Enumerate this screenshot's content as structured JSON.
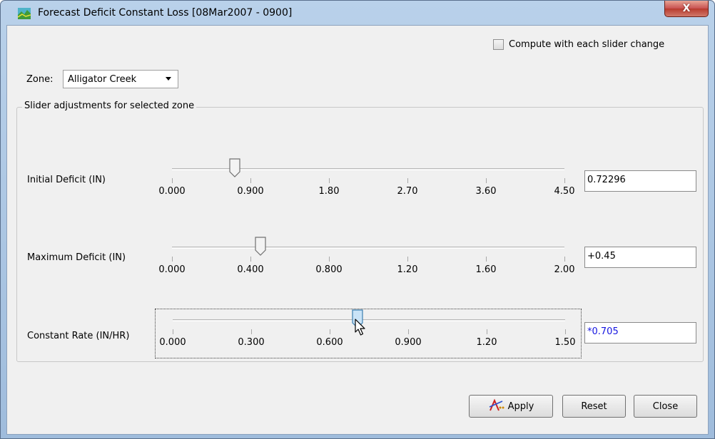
{
  "window": {
    "title": "Forecast Deficit Constant Loss [08Mar2007 - 0900]",
    "close_glyph": "X"
  },
  "compute_checkbox": {
    "label": "Compute with each slider change",
    "checked": false
  },
  "zone": {
    "label": "Zone:",
    "selected": "Alligator Creek"
  },
  "group": {
    "title": "Slider adjustments for selected zone"
  },
  "sliders": [
    {
      "label": "Initial Deficit (IN)",
      "ticks": [
        "0.000",
        "0.900",
        "1.80",
        "2.70",
        "3.60",
        "4.50"
      ],
      "min": 0,
      "max": 4.5,
      "value": 0.72296,
      "value_text": "0.72296",
      "modified": false
    },
    {
      "label": "Maximum Deficit (IN)",
      "ticks": [
        "0.000",
        "0.400",
        "0.800",
        "1.20",
        "1.60",
        "2.00"
      ],
      "min": 0,
      "max": 2.0,
      "value": 0.45,
      "value_text": "+0.45",
      "modified": false
    },
    {
      "label": "Constant Rate (IN/HR)",
      "ticks": [
        "0.000",
        "0.300",
        "0.600",
        "0.900",
        "1.20",
        "1.50"
      ],
      "min": 0,
      "max": 1.5,
      "value": 0.705,
      "value_text": "*0.705",
      "modified": true,
      "focused": true
    }
  ],
  "buttons": {
    "apply": "Apply",
    "reset": "Reset",
    "close": "Close"
  },
  "colors": {
    "modified_text": "#1515e0",
    "title_bar": "#b9d1ea",
    "close_button": "#c75050"
  }
}
